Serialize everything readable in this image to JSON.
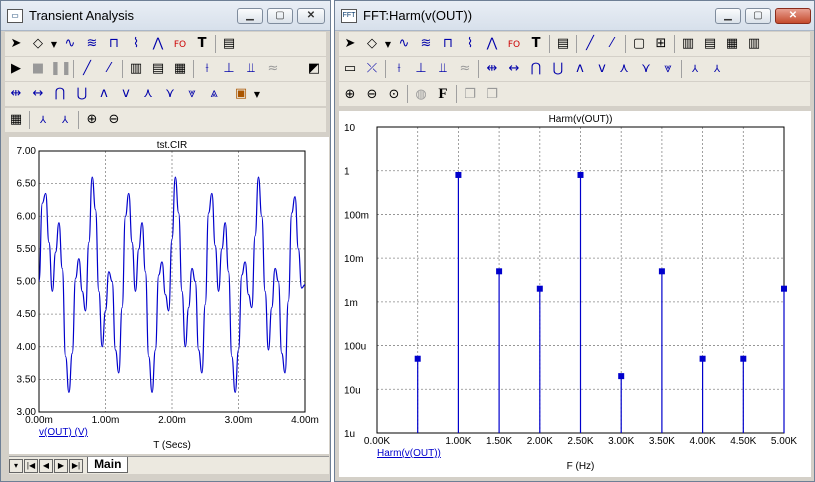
{
  "left_window": {
    "title": "Transient Analysis",
    "plot_title": "tst.CIR",
    "y_ticks": [
      "7.00",
      "6.50",
      "6.00",
      "5.50",
      "5.00",
      "4.50",
      "4.00",
      "3.50",
      "3.00"
    ],
    "x_ticks": [
      "0.00m",
      "1.00m",
      "2.00m",
      "3.00m",
      "4.00m"
    ],
    "trace_label": "v(OUT) (V)",
    "x_axis_label": "T (Secs)",
    "tab_label": "Main",
    "trace_color": "#0000cc"
  },
  "right_window": {
    "title": "FFT:Harm(v(OUT))",
    "plot_title": "Harm(v(OUT))",
    "y_ticks": [
      "10",
      "1",
      "100m",
      "10m",
      "1m",
      "100u",
      "10u",
      "1u"
    ],
    "x_ticks": [
      "0.00K",
      "1.00K",
      "1.50K",
      "2.00K",
      "2.50K",
      "3.00K",
      "3.50K",
      "4.00K",
      "4.50K",
      "5.00K"
    ],
    "trace_label": "Harm(v(OUT))",
    "x_axis_label": "F (Hz)",
    "trace_color": "#0000cc"
  },
  "chart_data": [
    {
      "type": "line",
      "title": "tst.CIR",
      "xlabel": "T (Secs)",
      "ylabel": "v(OUT) (V)",
      "xlim": [
        0,
        4.0
      ],
      "ylim": [
        3.0,
        7.0
      ],
      "x_unit": "ms",
      "grid": true,
      "series": [
        {
          "name": "v(OUT) (V)",
          "x": [
            0,
            0.05,
            0.1,
            0.15,
            0.2,
            0.25,
            0.3,
            0.35,
            0.4,
            0.45,
            0.5,
            0.55,
            0.6,
            0.65,
            0.7,
            0.75,
            0.8,
            0.85,
            0.9,
            0.95,
            1.0,
            1.05,
            1.1,
            1.15,
            1.2,
            1.25,
            1.3,
            1.35,
            1.4,
            1.45,
            1.5,
            1.55,
            1.6,
            1.65,
            1.7,
            1.75,
            1.8,
            1.85,
            1.9,
            1.95,
            2.0,
            2.05,
            2.1,
            2.15,
            2.2,
            2.25,
            2.3,
            2.35,
            2.4,
            2.45,
            2.5,
            2.55,
            2.6,
            2.65,
            2.7,
            2.75,
            2.8,
            2.85,
            2.9,
            2.95,
            3.0,
            3.05,
            3.1,
            3.15,
            3.2,
            3.25,
            3.3,
            3.35,
            3.4,
            3.45,
            3.5,
            3.55,
            3.6,
            3.65,
            3.7,
            3.75,
            3.8,
            3.85,
            3.9,
            3.95,
            4.0
          ],
          "values": [
            5.0,
            6.2,
            6.35,
            5.6,
            4.85,
            5.45,
            5.9,
            5.2,
            3.85,
            3.3,
            3.9,
            5.05,
            5.35,
            4.85,
            4.55,
            5.6,
            6.6,
            6.1,
            4.85,
            4.0,
            4.55,
            5.15,
            5.0,
            3.95,
            3.6,
            4.6,
            6.0,
            6.35,
            5.6,
            4.85,
            5.5,
            5.9,
            5.15,
            3.85,
            3.3,
            3.95,
            5.1,
            5.3,
            4.8,
            4.55,
            5.65,
            6.6,
            6.05,
            4.85,
            4.0,
            4.6,
            5.2,
            5.0,
            3.95,
            3.6,
            4.65,
            6.05,
            6.35,
            5.55,
            4.85,
            5.5,
            5.9,
            5.15,
            3.85,
            3.3,
            3.95,
            5.1,
            5.3,
            4.8,
            4.6,
            5.7,
            6.6,
            6.0,
            4.85,
            3.95,
            4.6,
            5.2,
            5.0,
            3.9,
            3.6,
            4.7,
            6.05,
            6.3,
            5.5,
            4.9,
            4.95
          ]
        }
      ]
    },
    {
      "type": "scatter",
      "title": "Harm(v(OUT))",
      "xlabel": "F (Hz)",
      "ylabel": "Harm(v(OUT))",
      "y_scale": "log",
      "ylim": [
        1e-06,
        10
      ],
      "xlim": [
        0,
        5000
      ],
      "grid": true,
      "series": [
        {
          "name": "Harm(v(OUT))",
          "x": [
            500,
            1000,
            1500,
            2000,
            2500,
            3000,
            3500,
            4000,
            4500,
            5000
          ],
          "values": [
            5e-05,
            0.8,
            0.005,
            0.002,
            0.8,
            2e-05,
            0.005,
            5e-05,
            5e-05,
            0.002
          ]
        }
      ]
    }
  ]
}
